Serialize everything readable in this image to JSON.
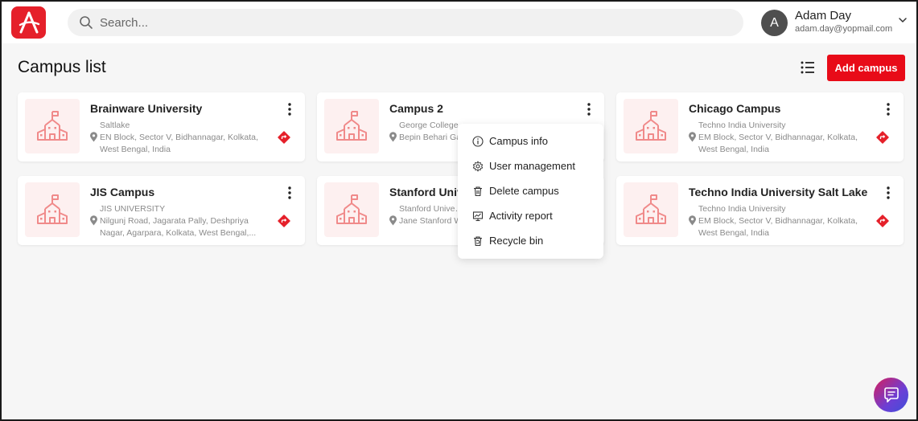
{
  "header": {
    "search_placeholder": "Search...",
    "user": {
      "initial": "A",
      "name": "Adam Day",
      "email": "adam.day@yopmail.com"
    }
  },
  "page": {
    "title": "Campus list",
    "add_button": "Add campus"
  },
  "campuses": [
    {
      "name": "Brainware University",
      "org": "Saltlake",
      "address": "EN Block, Sector V, Bidhannagar, Kolkata, West Bengal, India"
    },
    {
      "name": "Campus 2",
      "org": "George College",
      "address": "Bepin Behari Ga… Bowbazar, Kolk…"
    },
    {
      "name": "Chicago Campus",
      "org": "Techno India University",
      "address": "EM Block, Sector V, Bidhannagar, Kolkata, West Bengal, India"
    },
    {
      "name": "JIS Campus",
      "org": "JIS UNIVERSITY",
      "address": "Nilgunj Road, Jagarata Pally, Deshpriya Nagar, Agarpara, Kolkata, West Bengal,..."
    },
    {
      "name": "Stanford Univ…",
      "org": "Stanford Unive…",
      "address": "Jane Stanford W…"
    },
    {
      "name": "Techno India University Salt Lake",
      "org": "Techno India University",
      "address": "EM Block, Sector V, Bidhannagar, Kolkata, West Bengal, India"
    }
  ],
  "context_menu": {
    "items": [
      {
        "label": "Campus info",
        "icon": "info-icon"
      },
      {
        "label": "User management",
        "icon": "gear-icon"
      },
      {
        "label": "Delete campus",
        "icon": "trash-icon"
      },
      {
        "label": "Activity report",
        "icon": "report-icon"
      },
      {
        "label": "Recycle bin",
        "icon": "recycle-bin-icon"
      }
    ]
  },
  "colors": {
    "brand": "#e5202a",
    "accent": "#e80b18",
    "icon_pink": "#f08a8a"
  }
}
